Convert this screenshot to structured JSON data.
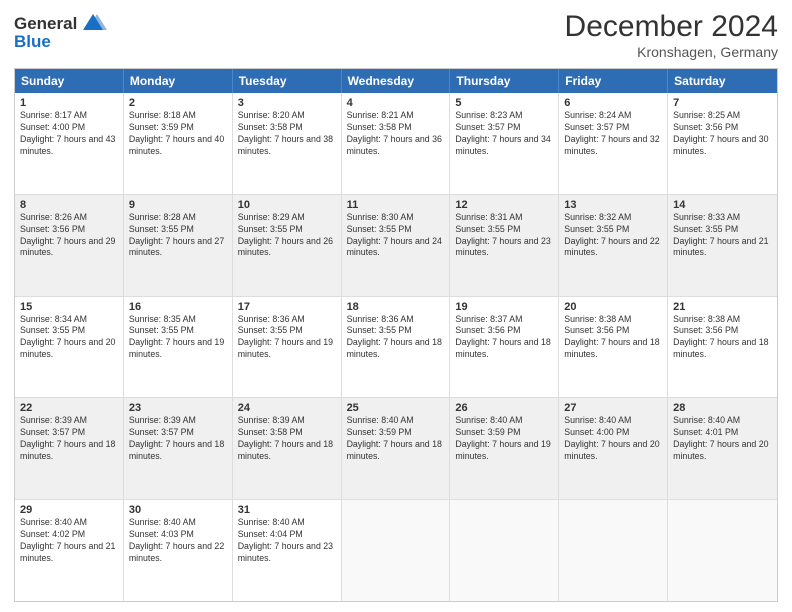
{
  "header": {
    "logo_line1": "General",
    "logo_line2": "Blue",
    "month": "December 2024",
    "location": "Kronshagen, Germany"
  },
  "days_of_week": [
    "Sunday",
    "Monday",
    "Tuesday",
    "Wednesday",
    "Thursday",
    "Friday",
    "Saturday"
  ],
  "rows": [
    [
      {
        "day": "1",
        "rise": "Sunrise: 8:17 AM",
        "set": "Sunset: 4:00 PM",
        "day_text": "Daylight: 7 hours and 43 minutes."
      },
      {
        "day": "2",
        "rise": "Sunrise: 8:18 AM",
        "set": "Sunset: 3:59 PM",
        "day_text": "Daylight: 7 hours and 40 minutes."
      },
      {
        "day": "3",
        "rise": "Sunrise: 8:20 AM",
        "set": "Sunset: 3:58 PM",
        "day_text": "Daylight: 7 hours and 38 minutes."
      },
      {
        "day": "4",
        "rise": "Sunrise: 8:21 AM",
        "set": "Sunset: 3:58 PM",
        "day_text": "Daylight: 7 hours and 36 minutes."
      },
      {
        "day": "5",
        "rise": "Sunrise: 8:23 AM",
        "set": "Sunset: 3:57 PM",
        "day_text": "Daylight: 7 hours and 34 minutes."
      },
      {
        "day": "6",
        "rise": "Sunrise: 8:24 AM",
        "set": "Sunset: 3:57 PM",
        "day_text": "Daylight: 7 hours and 32 minutes."
      },
      {
        "day": "7",
        "rise": "Sunrise: 8:25 AM",
        "set": "Sunset: 3:56 PM",
        "day_text": "Daylight: 7 hours and 30 minutes."
      }
    ],
    [
      {
        "day": "8",
        "rise": "Sunrise: 8:26 AM",
        "set": "Sunset: 3:56 PM",
        "day_text": "Daylight: 7 hours and 29 minutes."
      },
      {
        "day": "9",
        "rise": "Sunrise: 8:28 AM",
        "set": "Sunset: 3:55 PM",
        "day_text": "Daylight: 7 hours and 27 minutes."
      },
      {
        "day": "10",
        "rise": "Sunrise: 8:29 AM",
        "set": "Sunset: 3:55 PM",
        "day_text": "Daylight: 7 hours and 26 minutes."
      },
      {
        "day": "11",
        "rise": "Sunrise: 8:30 AM",
        "set": "Sunset: 3:55 PM",
        "day_text": "Daylight: 7 hours and 24 minutes."
      },
      {
        "day": "12",
        "rise": "Sunrise: 8:31 AM",
        "set": "Sunset: 3:55 PM",
        "day_text": "Daylight: 7 hours and 23 minutes."
      },
      {
        "day": "13",
        "rise": "Sunrise: 8:32 AM",
        "set": "Sunset: 3:55 PM",
        "day_text": "Daylight: 7 hours and 22 minutes."
      },
      {
        "day": "14",
        "rise": "Sunrise: 8:33 AM",
        "set": "Sunset: 3:55 PM",
        "day_text": "Daylight: 7 hours and 21 minutes."
      }
    ],
    [
      {
        "day": "15",
        "rise": "Sunrise: 8:34 AM",
        "set": "Sunset: 3:55 PM",
        "day_text": "Daylight: 7 hours and 20 minutes."
      },
      {
        "day": "16",
        "rise": "Sunrise: 8:35 AM",
        "set": "Sunset: 3:55 PM",
        "day_text": "Daylight: 7 hours and 19 minutes."
      },
      {
        "day": "17",
        "rise": "Sunrise: 8:36 AM",
        "set": "Sunset: 3:55 PM",
        "day_text": "Daylight: 7 hours and 19 minutes."
      },
      {
        "day": "18",
        "rise": "Sunrise: 8:36 AM",
        "set": "Sunset: 3:55 PM",
        "day_text": "Daylight: 7 hours and 18 minutes."
      },
      {
        "day": "19",
        "rise": "Sunrise: 8:37 AM",
        "set": "Sunset: 3:56 PM",
        "day_text": "Daylight: 7 hours and 18 minutes."
      },
      {
        "day": "20",
        "rise": "Sunrise: 8:38 AM",
        "set": "Sunset: 3:56 PM",
        "day_text": "Daylight: 7 hours and 18 minutes."
      },
      {
        "day": "21",
        "rise": "Sunrise: 8:38 AM",
        "set": "Sunset: 3:56 PM",
        "day_text": "Daylight: 7 hours and 18 minutes."
      }
    ],
    [
      {
        "day": "22",
        "rise": "Sunrise: 8:39 AM",
        "set": "Sunset: 3:57 PM",
        "day_text": "Daylight: 7 hours and 18 minutes."
      },
      {
        "day": "23",
        "rise": "Sunrise: 8:39 AM",
        "set": "Sunset: 3:57 PM",
        "day_text": "Daylight: 7 hours and 18 minutes."
      },
      {
        "day": "24",
        "rise": "Sunrise: 8:39 AM",
        "set": "Sunset: 3:58 PM",
        "day_text": "Daylight: 7 hours and 18 minutes."
      },
      {
        "day": "25",
        "rise": "Sunrise: 8:40 AM",
        "set": "Sunset: 3:59 PM",
        "day_text": "Daylight: 7 hours and 18 minutes."
      },
      {
        "day": "26",
        "rise": "Sunrise: 8:40 AM",
        "set": "Sunset: 3:59 PM",
        "day_text": "Daylight: 7 hours and 19 minutes."
      },
      {
        "day": "27",
        "rise": "Sunrise: 8:40 AM",
        "set": "Sunset: 4:00 PM",
        "day_text": "Daylight: 7 hours and 20 minutes."
      },
      {
        "day": "28",
        "rise": "Sunrise: 8:40 AM",
        "set": "Sunset: 4:01 PM",
        "day_text": "Daylight: 7 hours and 20 minutes."
      }
    ],
    [
      {
        "day": "29",
        "rise": "Sunrise: 8:40 AM",
        "set": "Sunset: 4:02 PM",
        "day_text": "Daylight: 7 hours and 21 minutes."
      },
      {
        "day": "30",
        "rise": "Sunrise: 8:40 AM",
        "set": "Sunset: 4:03 PM",
        "day_text": "Daylight: 7 hours and 22 minutes."
      },
      {
        "day": "31",
        "rise": "Sunrise: 8:40 AM",
        "set": "Sunset: 4:04 PM",
        "day_text": "Daylight: 7 hours and 23 minutes."
      },
      null,
      null,
      null,
      null
    ]
  ],
  "row_shading": [
    false,
    true,
    false,
    true,
    false
  ]
}
